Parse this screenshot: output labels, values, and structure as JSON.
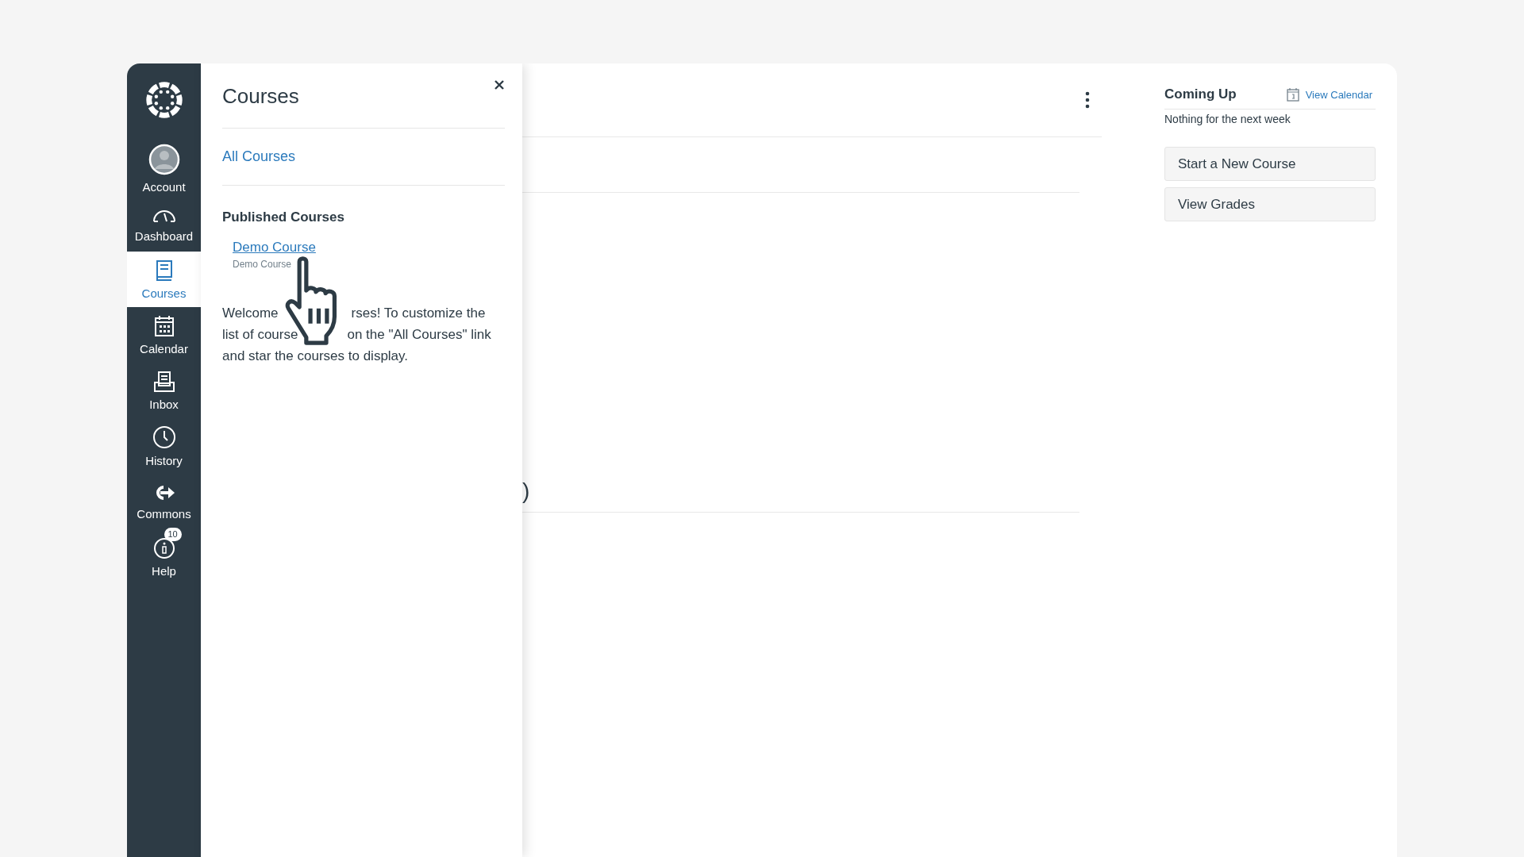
{
  "sidebar": {
    "items": [
      {
        "label": "Account",
        "kind": "account",
        "selected": false
      },
      {
        "label": "Dashboard",
        "kind": "dashboard",
        "selected": false
      },
      {
        "label": "Courses",
        "kind": "courses",
        "selected": true
      },
      {
        "label": "Calendar",
        "kind": "calendar",
        "selected": false
      },
      {
        "label": "Inbox",
        "kind": "inbox",
        "selected": false
      },
      {
        "label": "History",
        "kind": "history",
        "selected": false
      },
      {
        "label": "Commons",
        "kind": "commons",
        "selected": false
      },
      {
        "label": "Help",
        "kind": "help",
        "selected": false,
        "badge": "10"
      }
    ]
  },
  "courses_panel": {
    "title": "Courses",
    "all_link": "All Courses",
    "section_title": "Published Courses",
    "courses": [
      {
        "name": "Demo Course",
        "subtitle": "Demo Course"
      }
    ],
    "welcome_lines": [
      {
        "parts": [
          "Welcome",
          "rses! To customize the"
        ]
      },
      {
        "parts": [
          "list of course",
          "on the \"All Courses\" link"
        ]
      },
      {
        "parts": [
          "and star the courses to display."
        ]
      }
    ]
  },
  "main": {
    "fragment": ")"
  },
  "coming_up": {
    "title": "Coming Up",
    "calendar_link": "View Calendar",
    "empty": "Nothing for the next week"
  },
  "actions": [
    "Start a New Course",
    "View Grades"
  ]
}
